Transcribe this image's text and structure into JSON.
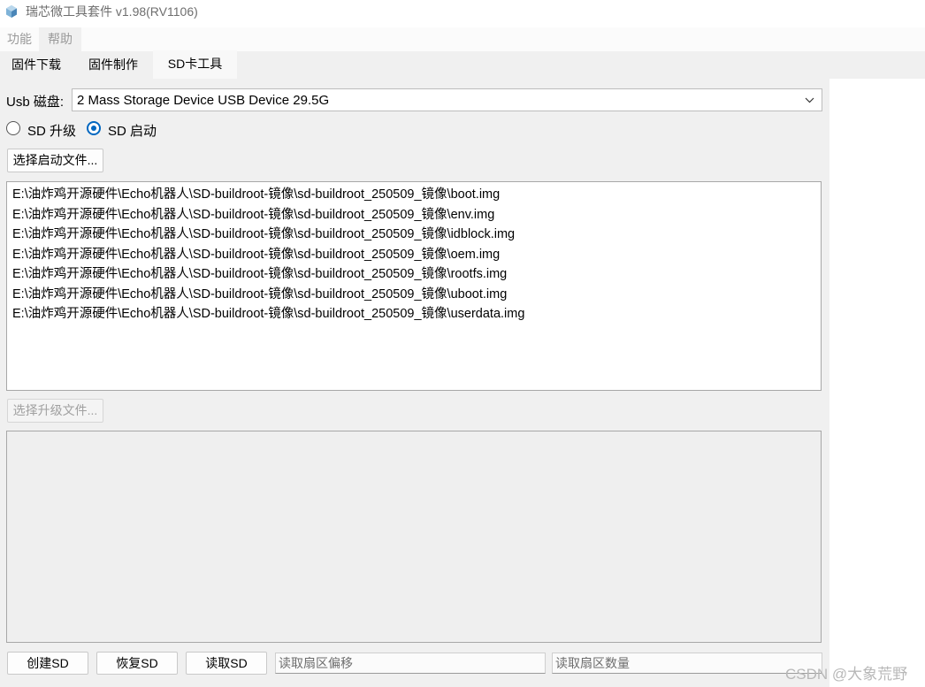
{
  "window": {
    "title": "瑞芯微工具套件 v1.98(RV1106)",
    "icon": "rockchip-app-icon"
  },
  "menu": [
    "功能",
    "帮助"
  ],
  "tabs": [
    {
      "label": "固件下载",
      "active": false
    },
    {
      "label": "固件制作",
      "active": false
    },
    {
      "label": "SD卡工具",
      "active": true
    }
  ],
  "usb": {
    "label": "Usb 磁盘:",
    "selected": "2 Mass Storage Device USB Device 29.5G"
  },
  "mode": {
    "options": [
      {
        "label": "SD 升级",
        "checked": false
      },
      {
        "label": "SD 启动",
        "checked": true
      }
    ]
  },
  "buttons": {
    "select_boot": "选择启动文件...",
    "select_upgrade": "选择升级文件...",
    "create_sd": "创建SD",
    "restore_sd": "恢复SD",
    "read_sd": "读取SD"
  },
  "boot_files": [
    "E:\\油炸鸡开源硬件\\Echo机器人\\SD-buildroot-镜像\\sd-buildroot_250509_镜像\\boot.img",
    "E:\\油炸鸡开源硬件\\Echo机器人\\SD-buildroot-镜像\\sd-buildroot_250509_镜像\\env.img",
    "E:\\油炸鸡开源硬件\\Echo机器人\\SD-buildroot-镜像\\sd-buildroot_250509_镜像\\idblock.img",
    "E:\\油炸鸡开源硬件\\Echo机器人\\SD-buildroot-镜像\\sd-buildroot_250509_镜像\\oem.img",
    "E:\\油炸鸡开源硬件\\Echo机器人\\SD-buildroot-镜像\\sd-buildroot_250509_镜像\\rootfs.img",
    "E:\\油炸鸡开源硬件\\Echo机器人\\SD-buildroot-镜像\\sd-buildroot_250509_镜像\\uboot.img",
    "E:\\油炸鸡开源硬件\\Echo机器人\\SD-buildroot-镜像\\sd-buildroot_250509_镜像\\userdata.img"
  ],
  "inputs": {
    "sector_offset_placeholder": "读取扇区偏移",
    "sector_count_placeholder": "读取扇区数量"
  },
  "watermark": "CSDN @大象荒野",
  "colors": {
    "accent": "#0067c0",
    "panel_bg": "#f0f0f0"
  }
}
